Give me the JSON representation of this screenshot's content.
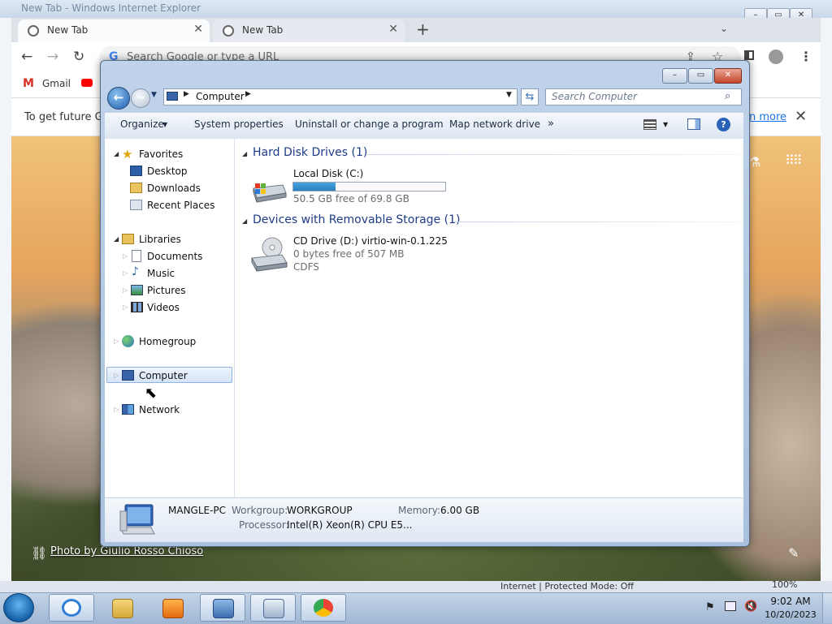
{
  "ie": {
    "title": "New Tab - Windows Internet Explorer",
    "status_text": "Internet | Protected Mode: Off",
    "zoom": "100%"
  },
  "chrome": {
    "tabs": [
      {
        "label": "New Tab",
        "close": "✕"
      },
      {
        "label": "New Tab",
        "close": "✕"
      }
    ],
    "new_tab": "+",
    "tab_search": "⌄",
    "omnibox_placeholder": "Search Google or type a URL",
    "bookmarks": [
      {
        "label": "Gmail"
      }
    ],
    "infobar_text": "To get future Go",
    "infobar_link": "n more",
    "infobar_close": "✕",
    "photo_credit": "Photo by Giulio Rosso Chioso"
  },
  "explorer": {
    "window_controls": {
      "minimize": "–",
      "maximize": "▭",
      "close": "✕"
    },
    "address_path": "Computer",
    "search_placeholder": "Search Computer",
    "commands": {
      "organize": "Organize",
      "system_properties": "System properties",
      "uninstall": "Uninstall or change a program",
      "map_drive": "Map network drive",
      "more": "»"
    },
    "help": "?",
    "nav": {
      "favorites": "Favorites",
      "desktop": "Desktop",
      "downloads": "Downloads",
      "recent": "Recent Places",
      "libraries": "Libraries",
      "documents": "Documents",
      "music": "Music",
      "pictures": "Pictures",
      "videos": "Videos",
      "homegroup": "Homegroup",
      "computer": "Computer",
      "network": "Network"
    },
    "groups": {
      "hdd": {
        "title": "Hard Disk Drives (1)",
        "name": "Local Disk (C:)",
        "free": "50.5 GB free of 69.8 GB",
        "used_fraction": 0.28
      },
      "removable": {
        "title": "Devices with Removable Storage (1)",
        "name": "CD Drive (D:) virtio-win-0.1.225",
        "free": "0 bytes free of 507 MB",
        "fs": "CDFS"
      }
    },
    "details": {
      "pc_name": "MANGLE-PC",
      "workgroup_label": "Workgroup:",
      "workgroup": "WORKGROUP",
      "memory_label": "Memory:",
      "memory": "6.00 GB",
      "processor_label": "Processor:",
      "processor": "Intel(R) Xeon(R) CPU E5..."
    }
  },
  "taskbar": {
    "time": "9:02 AM",
    "date": "10/20/2023"
  }
}
